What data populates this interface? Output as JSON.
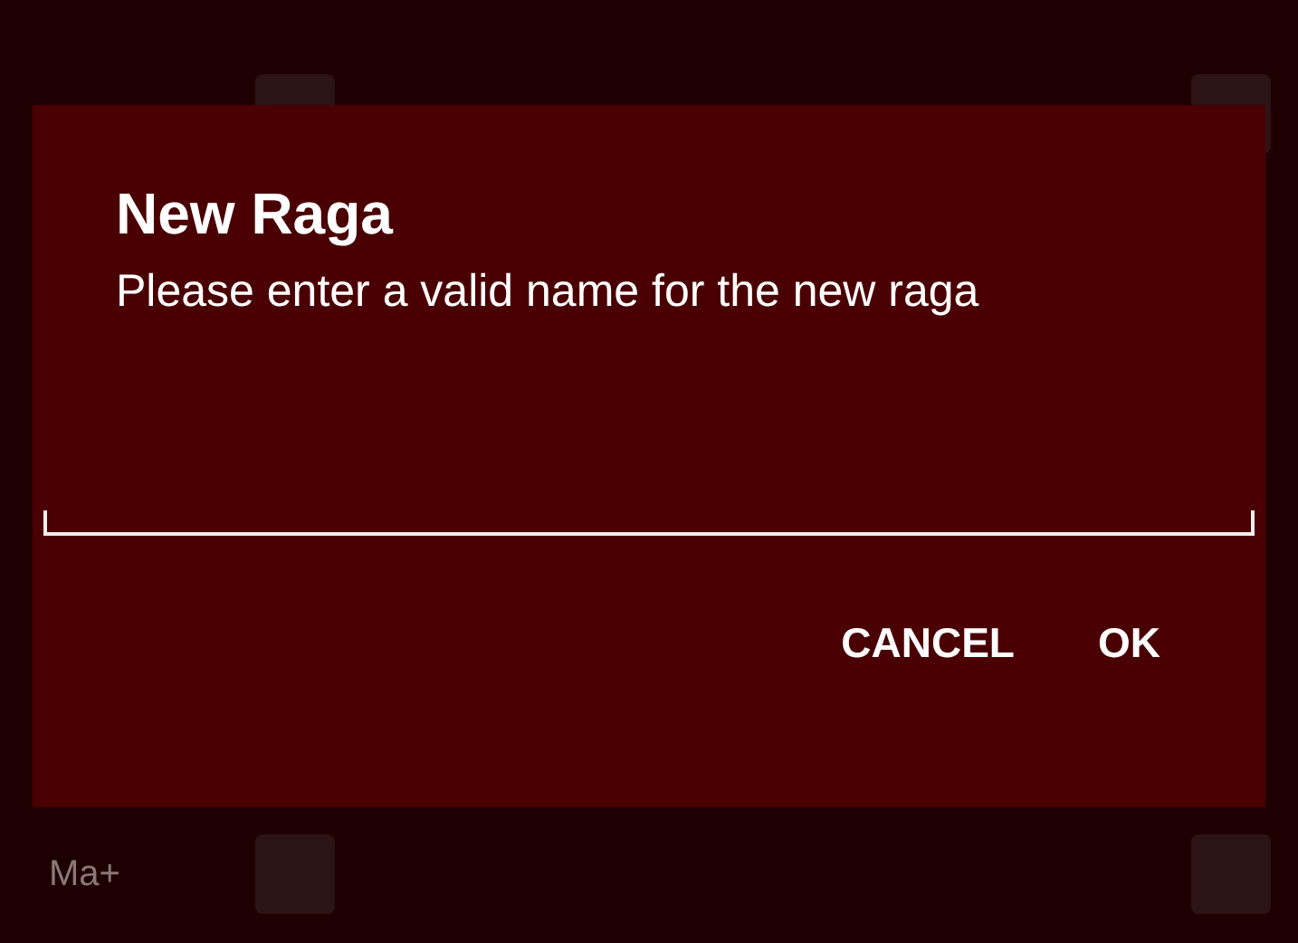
{
  "background_rows": [
    {
      "checked": false
    },
    {
      "label": "Ma+",
      "checked": false
    }
  ],
  "dialog": {
    "title": "New Raga",
    "message": "Please enter a valid name for the new raga",
    "buttons": [
      "CANCEL",
      "OK"
    ]
  }
}
